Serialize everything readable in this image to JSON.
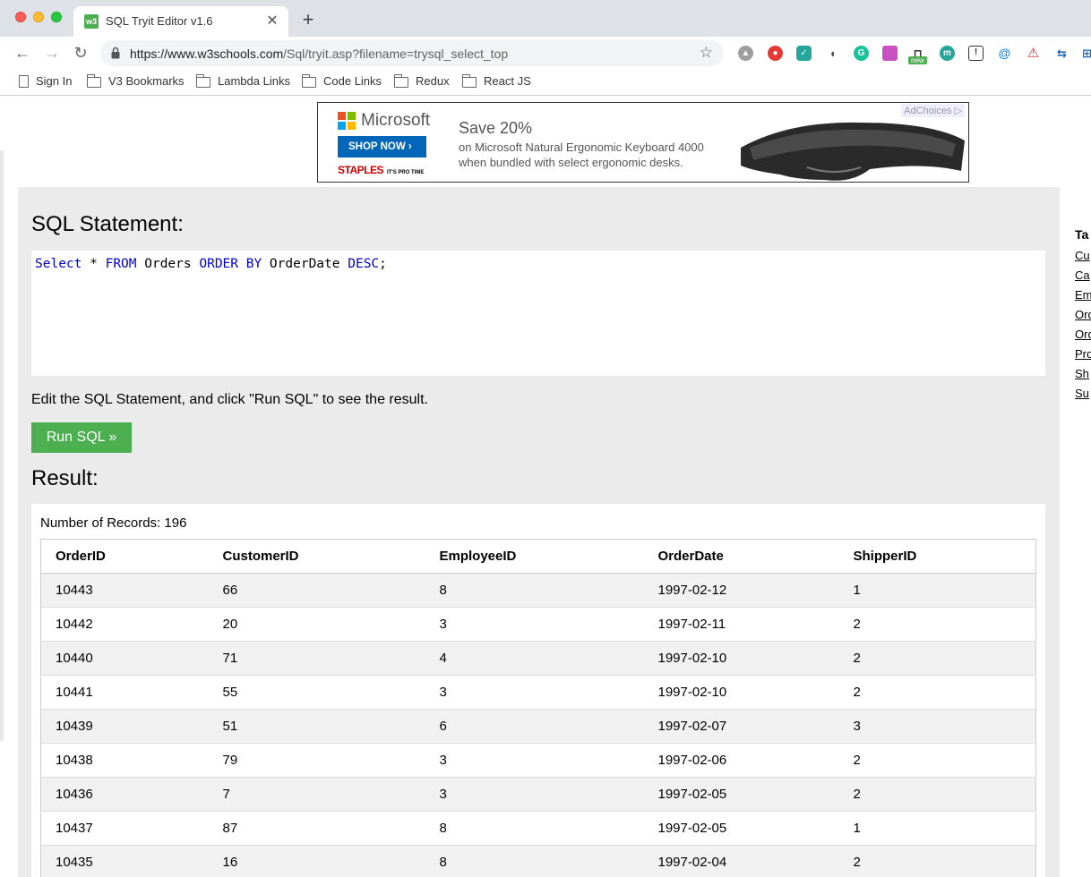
{
  "browser": {
    "tab_title": "SQL Tryit Editor v1.6",
    "tab_favicon": "w3",
    "url_host": "https://www.w3schools.com",
    "url_path": "/Sql/tryit.asp?filename=trysql_select_top",
    "bookmarks": [
      "Sign In",
      "V3 Bookmarks",
      "Lambda Links",
      "Code Links",
      "Redux",
      "React JS"
    ],
    "extension_badge": "new"
  },
  "ad": {
    "brand": "Microsoft",
    "cta": "SHOP NOW",
    "retailer": "STAPLES",
    "retailer_tagline": "IT'S PRO TIME",
    "headline": "Save 20%",
    "body_line1": "on Microsoft Natural Ergonomic Keyboard 4000",
    "body_line2": "when bundled with select ergonomic desks.",
    "adchoices": "AdChoices"
  },
  "editor": {
    "heading": "SQL Statement:",
    "hint": "Edit the SQL Statement, and click \"Run SQL\" to see the result.",
    "run_label": "Run SQL »",
    "sql": {
      "kw_select": "Select",
      "star": " * ",
      "kw_from": "FROM",
      "table": " Orders ",
      "kw_order": "ORDER BY",
      "column": " OrderDate ",
      "kw_desc": "DESC",
      "end": ";"
    }
  },
  "result": {
    "heading": "Result:",
    "count_text": "Number of Records: 196",
    "columns": [
      "OrderID",
      "CustomerID",
      "EmployeeID",
      "OrderDate",
      "ShipperID"
    ],
    "rows": [
      [
        "10443",
        "66",
        "8",
        "1997-02-12",
        "1"
      ],
      [
        "10442",
        "20",
        "3",
        "1997-02-11",
        "2"
      ],
      [
        "10440",
        "71",
        "4",
        "1997-02-10",
        "2"
      ],
      [
        "10441",
        "55",
        "3",
        "1997-02-10",
        "2"
      ],
      [
        "10439",
        "51",
        "6",
        "1997-02-07",
        "3"
      ],
      [
        "10438",
        "79",
        "3",
        "1997-02-06",
        "2"
      ],
      [
        "10436",
        "7",
        "3",
        "1997-02-05",
        "2"
      ],
      [
        "10437",
        "87",
        "8",
        "1997-02-05",
        "1"
      ],
      [
        "10435",
        "16",
        "8",
        "1997-02-04",
        "2"
      ]
    ]
  },
  "sidebar": {
    "heading": "Ta",
    "links": [
      "Cu",
      "Ca",
      "Em",
      "Ord",
      "Ord",
      "Pro",
      "Sh",
      "Su"
    ]
  }
}
